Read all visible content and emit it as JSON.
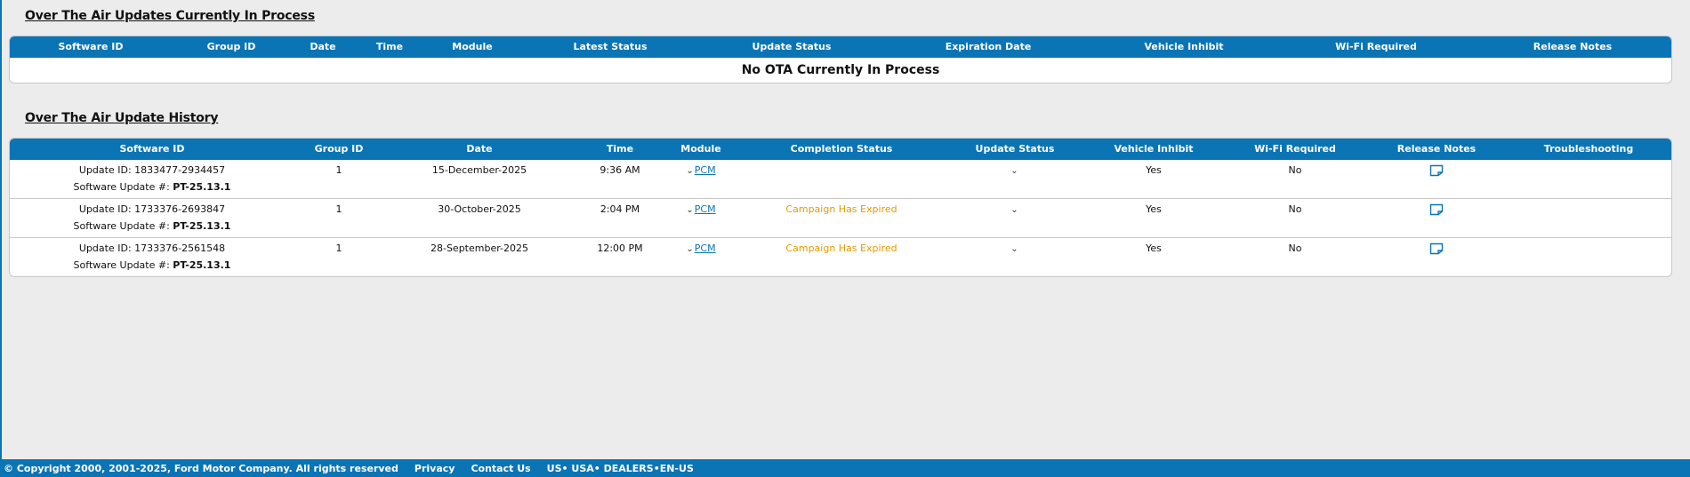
{
  "colors": {
    "header_blue": "#0b74b5",
    "expired_orange": "#e59a00"
  },
  "current": {
    "title": "Over The Air Updates Currently In Process",
    "columns": [
      "Software ID",
      "Group ID",
      "Date",
      "Time",
      "Module",
      "Latest Status",
      "Update Status",
      "Expiration Date",
      "Vehicle Inhibit",
      "Wi-Fi Required",
      "Release Notes"
    ],
    "empty_message": "No OTA Currently In Process"
  },
  "history": {
    "title": "Over The Air Update History",
    "columns": [
      "Software ID",
      "Group ID",
      "Date",
      "Time",
      "Module",
      "Completion Status",
      "Update Status",
      "Vehicle Inhibit",
      "Wi-Fi Required",
      "Release Notes",
      "Troubleshooting"
    ],
    "rows": [
      {
        "update_id": "Update ID: 1833477-2934457",
        "sw_label": "Software Update #: ",
        "sw_value": "PT-25.13.1",
        "group_id": "1",
        "date": "15-December-2025",
        "time": "9:36 AM",
        "module": "PCM",
        "completion_status": "",
        "update_status_icon": "chevron-down-icon",
        "vehicle_inhibit": "Yes",
        "wifi_required": "No",
        "release_notes_icon": "note-icon",
        "troubleshooting": ""
      },
      {
        "update_id": "Update ID: 1733376-2693847",
        "sw_label": "Software Update #: ",
        "sw_value": "PT-25.13.1",
        "group_id": "1",
        "date": "30-October-2025",
        "time": "2:04 PM",
        "module": "PCM",
        "completion_status": "Campaign Has Expired",
        "update_status_icon": "chevron-down-icon",
        "vehicle_inhibit": "Yes",
        "wifi_required": "No",
        "release_notes_icon": "note-icon",
        "troubleshooting": ""
      },
      {
        "update_id": "Update ID: 1733376-2561548",
        "sw_label": "Software Update #: ",
        "sw_value": "PT-25.13.1",
        "group_id": "1",
        "date": "28-September-2025",
        "time": "12:00 PM",
        "module": "PCM",
        "completion_status": "Campaign Has Expired",
        "update_status_icon": "chevron-down-icon",
        "vehicle_inhibit": "Yes",
        "wifi_required": "No",
        "release_notes_icon": "note-icon",
        "troubleshooting": ""
      }
    ]
  },
  "footer": {
    "copyright": "© Copyright 2000, 2001-2025, Ford Motor Company. All rights reserved",
    "privacy": "Privacy",
    "contact": "Contact Us",
    "locale": "US• USA• DEALERS•EN-US"
  }
}
